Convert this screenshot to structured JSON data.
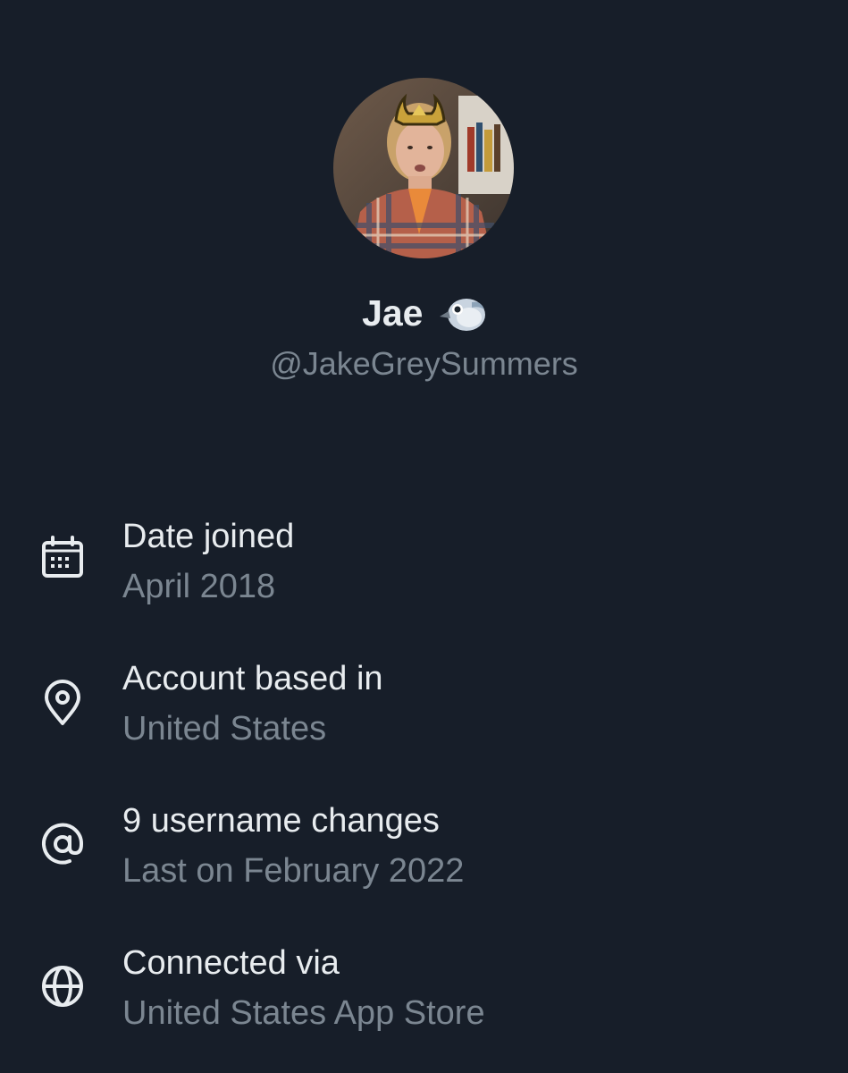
{
  "profile": {
    "display_name": "Jae",
    "name_emoji": "bird-emoji",
    "handle": "@JakeGreySummers"
  },
  "details": [
    {
      "icon": "calendar-icon",
      "title": "Date joined",
      "value": "April 2018"
    },
    {
      "icon": "location-pin-icon",
      "title": "Account based in",
      "value": "United States"
    },
    {
      "icon": "at-sign-icon",
      "title": "9 username changes",
      "value": "Last on February 2022"
    },
    {
      "icon": "globe-icon",
      "title": "Connected via",
      "value": "United States App Store"
    }
  ],
  "colors": {
    "background": "#171e29",
    "primary_text": "#e8ecef",
    "secondary_text": "#7b8691"
  }
}
